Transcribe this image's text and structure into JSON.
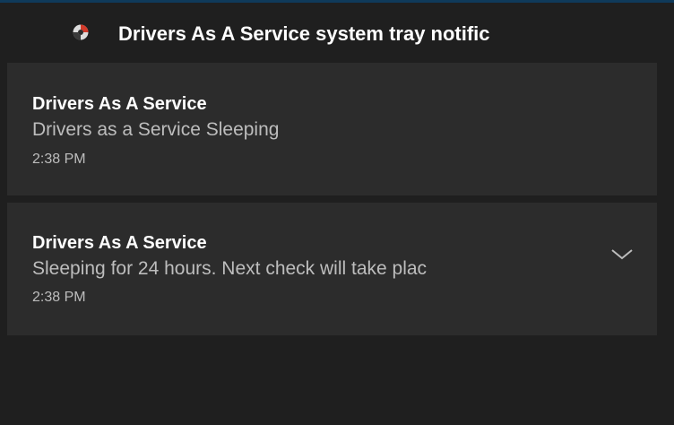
{
  "header": {
    "icon": "app-icon",
    "title": "Drivers As A Service system tray notific"
  },
  "notifications": [
    {
      "title": "Drivers As A Service",
      "body": "Drivers as a Service Sleeping",
      "time": "2:38 PM"
    },
    {
      "title": "Drivers As A Service",
      "body": "Sleeping for 24 hours. Next check will take plac",
      "time": "2:38 PM",
      "expand_icon": "chevron-down-icon"
    }
  ],
  "colors": {
    "background": "#1f1f1f",
    "card": "#2c2c2c",
    "title_text": "#ffffff",
    "secondary_text": "#bdbdbd",
    "accent": "#0f3a5a"
  }
}
